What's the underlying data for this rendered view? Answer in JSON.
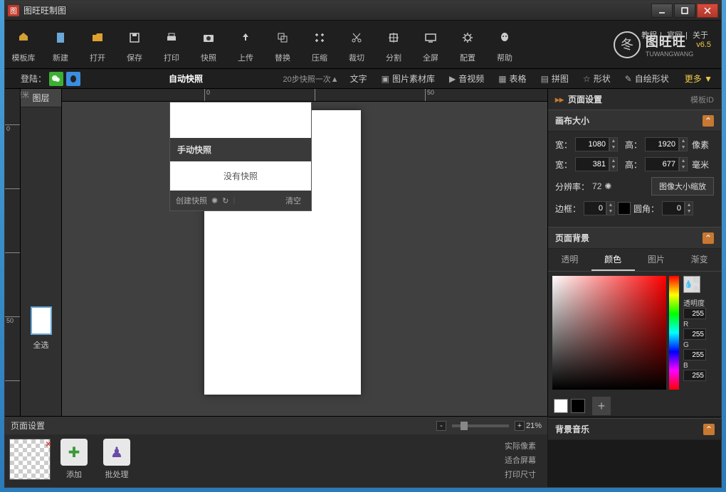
{
  "app": {
    "title": "图旺旺制图"
  },
  "window_controls": {
    "min": "–",
    "max": "□",
    "close": "×"
  },
  "top_links": {
    "tutorial": "教程",
    "official": "官网",
    "about": "关于"
  },
  "logo": {
    "name": "图旺旺",
    "sub": "TUWANGWANG",
    "version": "v6.5"
  },
  "toolbar": [
    {
      "label": "模板库",
      "icon": "home"
    },
    {
      "label": "新建",
      "icon": "file"
    },
    {
      "label": "打开",
      "icon": "folder"
    },
    {
      "label": "保存",
      "icon": "save"
    },
    {
      "label": "打印",
      "icon": "print"
    },
    {
      "label": "快照",
      "icon": "camera"
    },
    {
      "label": "上传",
      "icon": "upload"
    },
    {
      "label": "替换",
      "icon": "swap"
    },
    {
      "label": "压缩",
      "icon": "compress"
    },
    {
      "label": "裁切",
      "icon": "cut"
    },
    {
      "label": "分割",
      "icon": "crop"
    },
    {
      "label": "全屏",
      "icon": "screen"
    },
    {
      "label": "配置",
      "icon": "gear"
    },
    {
      "label": "帮助",
      "icon": "help"
    }
  ],
  "login": {
    "label": "登陆："
  },
  "subbar": {
    "auto_snapshot": "自动快照",
    "snapshot_info": "20步快照一次▲",
    "text": "文字",
    "image_lib": "图片素材库",
    "audio_video": "音视频",
    "table": "表格",
    "puzzle": "拼图",
    "shape": "形状",
    "freehand": "自绘形状",
    "more": "更多 ▼"
  },
  "snapshot_menu": {
    "manual": "手动快照",
    "none": "没有快照",
    "create": "创建快照",
    "clear": "清空"
  },
  "ruler_unit": "厘米",
  "layers": {
    "title": "图层",
    "select_all": "全选"
  },
  "right": {
    "header": "页面设置",
    "template_id": "模板ID",
    "canvas_size": "画布大小",
    "width": "宽：",
    "height": "高：",
    "px_w": "1080",
    "px_h": "1920",
    "unit_px": "像素",
    "mm_w": "381",
    "mm_h": "677",
    "unit_mm": "毫米",
    "resolution_lbl": "分辨率：",
    "resolution": "72",
    "resize_btn": "图像大小缩放",
    "border_lbl": "边框：",
    "border": "0",
    "radius_lbl": "圆角：",
    "radius": "0",
    "page_bg": "页面背景",
    "bg_tabs": {
      "transparent": "透明",
      "color": "颜色",
      "image": "图片",
      "gradient": "渐变"
    },
    "picker": {
      "eyedrop": "取色",
      "alpha_lbl": "透明度",
      "alpha": "255",
      "r_lbl": "R",
      "r": "255",
      "g_lbl": "G",
      "g": "255",
      "b_lbl": "B",
      "b": "255"
    },
    "bg_music": "背景音乐"
  },
  "bottom": {
    "title": "页面设置",
    "zoom": "21%",
    "add": "添加",
    "batch": "批处理",
    "actual_px": "实际像素",
    "fit_screen": "适合屏幕",
    "print_size": "打印尺寸"
  }
}
